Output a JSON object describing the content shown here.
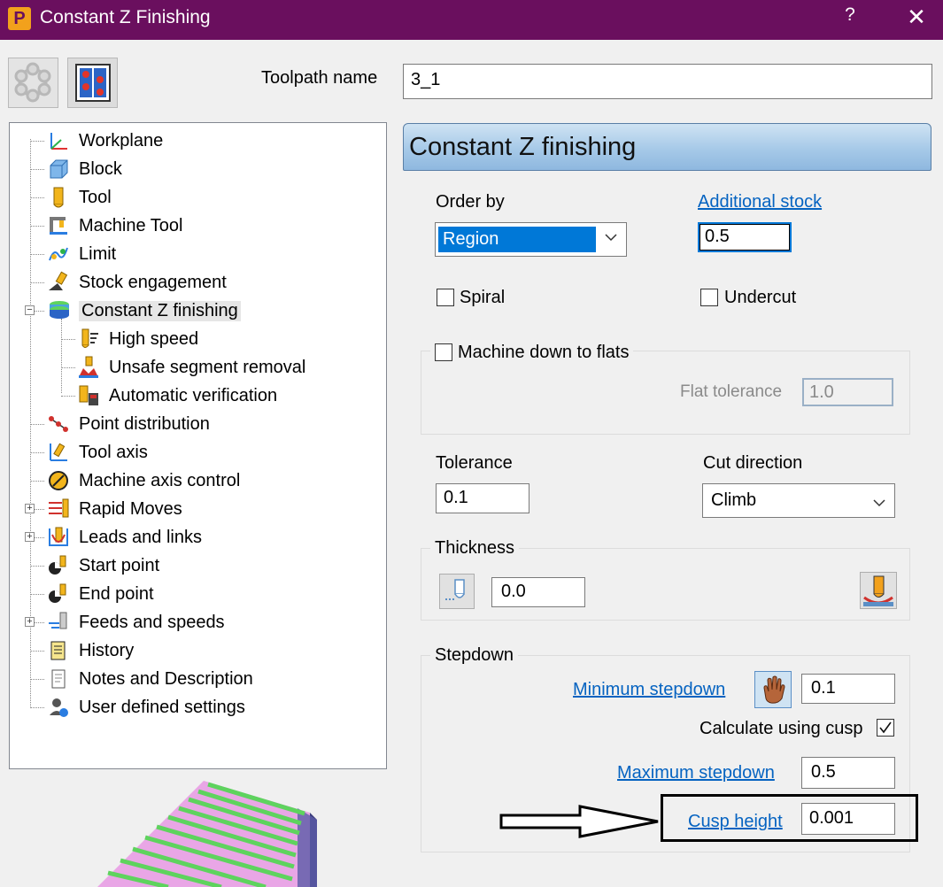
{
  "window": {
    "title": "Constant Z Finishing",
    "app_icon_letter": "P",
    "help_label": "?",
    "close_label": "✕",
    "title_bar_color": "#6a0f5e"
  },
  "toolbar": {
    "toolpath_name_label": "Toolpath name",
    "toolpath_name_value": "3_1"
  },
  "tree": {
    "items": [
      {
        "label": "Workplane",
        "icon": "workplane-icon"
      },
      {
        "label": "Block",
        "icon": "block-icon"
      },
      {
        "label": "Tool",
        "icon": "tool-icon"
      },
      {
        "label": "Machine Tool",
        "icon": "machine-tool-icon"
      },
      {
        "label": "Limit",
        "icon": "limit-icon"
      },
      {
        "label": "Stock engagement",
        "icon": "stock-engagement-icon"
      },
      {
        "label": "Constant Z finishing",
        "icon": "constant-z-icon",
        "selected": true,
        "expanded": true
      },
      {
        "label": "High speed",
        "icon": "high-speed-icon"
      },
      {
        "label": "Unsafe segment removal",
        "icon": "unsafe-segment-icon"
      },
      {
        "label": "Automatic verification",
        "icon": "verification-icon"
      },
      {
        "label": "Point distribution",
        "icon": "point-distribution-icon"
      },
      {
        "label": "Tool axis",
        "icon": "tool-axis-icon"
      },
      {
        "label": "Machine axis control",
        "icon": "machine-axis-icon"
      },
      {
        "label": "Rapid Moves",
        "icon": "rapid-moves-icon",
        "expandable": true
      },
      {
        "label": "Leads and links",
        "icon": "leads-links-icon",
        "expandable": true
      },
      {
        "label": "Start point",
        "icon": "start-point-icon"
      },
      {
        "label": "End point",
        "icon": "end-point-icon"
      },
      {
        "label": "Feeds and speeds",
        "icon": "feeds-speeds-icon",
        "expandable": true
      },
      {
        "label": "History",
        "icon": "history-icon"
      },
      {
        "label": "Notes and Description",
        "icon": "notes-icon"
      },
      {
        "label": "User defined settings",
        "icon": "user-settings-icon"
      }
    ]
  },
  "panel": {
    "header": "Constant Z finishing",
    "order_by_label": "Order by",
    "order_by_value": "Region",
    "additional_stock_label": "Additional stock",
    "additional_stock_value": "0.5",
    "spiral_label": "Spiral",
    "spiral_checked": false,
    "undercut_label": "Undercut",
    "undercut_checked": false,
    "machine_down_label": "Machine down to flats",
    "machine_down_checked": false,
    "flat_tolerance_label": "Flat tolerance",
    "flat_tolerance_value": "1.0",
    "tolerance_label": "Tolerance",
    "tolerance_value": "0.1",
    "cut_direction_label": "Cut direction",
    "cut_direction_value": "Climb",
    "thickness_label": "Thickness",
    "thickness_value": "0.0",
    "stepdown_label": "Stepdown",
    "min_stepdown_label": "Minimum stepdown",
    "min_stepdown_value": "0.1",
    "calc_cusp_label": "Calculate using cusp",
    "calc_cusp_checked": true,
    "max_stepdown_label": "Maximum stepdown",
    "max_stepdown_value": "0.5",
    "cusp_height_label": "Cusp height",
    "cusp_height_value": "0.001"
  },
  "colors": {
    "link": "#0563c1",
    "header_gradient_top": "#cfe3f3",
    "header_gradient_bottom": "#8fb8df",
    "preview_stripe": "#5ed35e",
    "preview_face": "#e9a6e6"
  }
}
